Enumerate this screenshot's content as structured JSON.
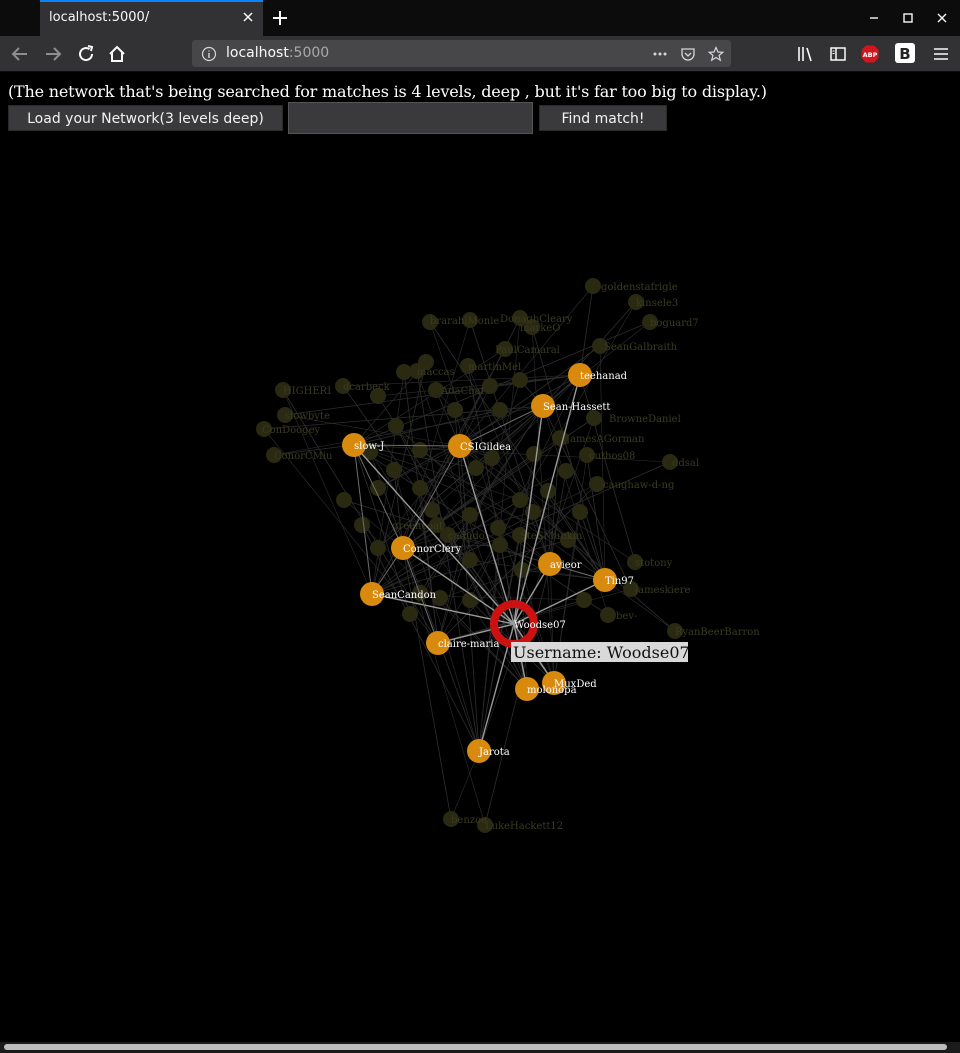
{
  "browser": {
    "tab_title": "localhost:5000/",
    "url_host": "localhost",
    "url_port": ":5000",
    "adblock_badge": "ABP",
    "b_badge": "B"
  },
  "page": {
    "info_text": "(The network that's being searched for matches is 4 levels, deep , but it's far too big to display.)",
    "load_button": "Load your Network(3 levels deep)",
    "search_value": "",
    "find_button": "Find match!",
    "tooltip": "Username: Woodse07"
  },
  "colors": {
    "background": "#000000",
    "node": "#d88a0f",
    "node_faded": "#2a2a12",
    "focus_ring": "#cc1111",
    "edge": "#9a9a9a",
    "edge_faded": "#2e2e2e"
  },
  "graph": {
    "center": "Woodse07",
    "highlighted_nodes": [
      "teehanad",
      "Sean-Hassett",
      "slow-J",
      "CSIGildea",
      "ConorClery",
      "avieor",
      "Tin97",
      "SeanCandon",
      "claire-maria",
      "MuxDed",
      "molonopa",
      "Jarota"
    ],
    "faded_labels": [
      "goldenstafrigle",
      "kinsele3",
      "boguard7",
      "SeanGalbraith",
      "DonaghCleary",
      "brarahiMonie",
      "markeO",
      "PaulCamaral",
      "HIGHERI",
      "dcarbeck",
      "martinMel",
      "maccas",
      "slowbyte",
      "ConDoogey",
      "ConorCMiu",
      "AdaChat",
      "BrowneDaniel",
      "JamesAGorman",
      "cuthos08",
      "ddsal",
      "caughaw-d-ng",
      "greencoat",
      "cadudo",
      "SteSMunkin",
      "stotony",
      "jameskiere",
      "bev-",
      "RyanBeerBarron",
      "benzoe",
      "LukeHackett12"
    ]
  }
}
